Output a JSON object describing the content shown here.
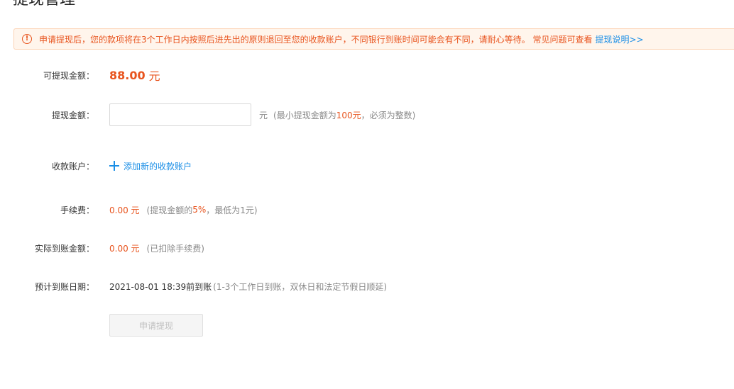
{
  "page": {
    "title": "提现管理"
  },
  "notice": {
    "icon": "!",
    "text": "申请提现后，您的款项将在3个工作日内按照后进先出的原则退回至您的收款账户，不同银行到账时间可能会有不同，请耐心等待。 常见问题可查看",
    "link": "提现说明>>"
  },
  "form": {
    "available": {
      "label": "可提现金额：",
      "amount": "88.00",
      "unit": "元"
    },
    "withdraw": {
      "label": "提现金额：",
      "value": "",
      "unit": "元",
      "hint_prefix": "(最小提现金额为 ",
      "hint_min": "100元",
      "hint_suffix": "，必须为整数)"
    },
    "account": {
      "label": "收款账户：",
      "add_link": "添加新的收款账户"
    },
    "fee": {
      "label": "手续费：",
      "amount": "0.00 元",
      "note_prefix": "(提现金额的",
      "note_rate": "5%",
      "note_suffix": "，最低为1元)"
    },
    "actual": {
      "label": "实际到账金额：",
      "amount": "0.00 元",
      "note": "(已扣除手续费)"
    },
    "eta": {
      "label": "预计到账日期：",
      "datetime": "2021-08-01 18:39前到账",
      "note": "(1-3个工作日到账，双休日和法定节假日顺延)"
    },
    "submit_label": "申请提现"
  }
}
